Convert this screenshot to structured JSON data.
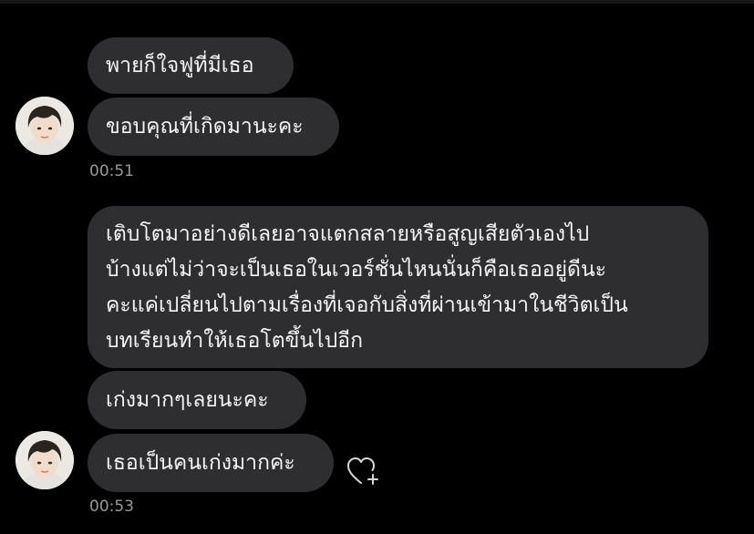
{
  "messages": [
    {
      "text": "พายก็ใจฟูที่มีเธอ"
    },
    {
      "text": "ขอบคุณที่เกิดมานะคะ"
    },
    {
      "text": "เติบโตมาอย่างดีเลยอาจแตกสลายหรือสูญเสียตัวเองไป\nบ้างแต่ไม่ว่าจะเป็นเธอในเวอร์ชั่นไหนนั่นก็คือเธออยู่ดีนะ\nคะแค่เปลี่ยนไปตามเรื่องที่เจอกับสิ่งที่ผ่านเข้ามาในชีวิตเป็น\nบทเรียนทำให้เธอโตขึ้นไปอีก"
    },
    {
      "text": "เก่งมากๆเลยนะคะ"
    },
    {
      "text": "เธอเป็นคนเก่งมากค่ะ"
    }
  ],
  "timestamps": [
    "00:51",
    "00:53"
  ],
  "icons": {
    "react": "heart-plus-icon",
    "avatar": "avatar"
  },
  "colors": {
    "background": "#000000",
    "bubble": "#2e2e30",
    "text": "#f4f4f4",
    "timestamp": "#9a9a9a"
  }
}
